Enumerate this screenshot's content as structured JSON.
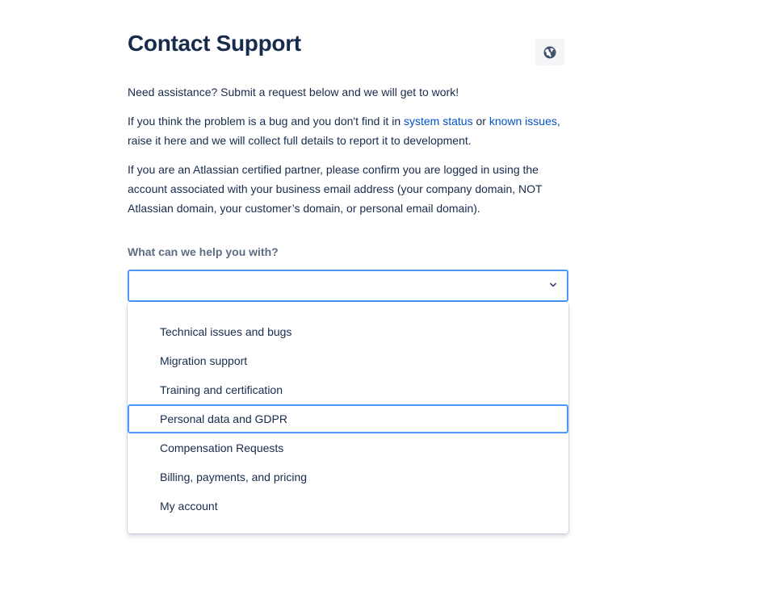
{
  "header": {
    "title": "Contact Support",
    "language_button_icon": "globe-icon"
  },
  "intro": {
    "line1": "Need assistance? Submit a request below and we will get to work!",
    "bug_text_before": "If you think the problem is a bug and you don't find it in ",
    "system_status_link": "system status",
    "bug_text_or": " or ",
    "known_issues_link": "known issues",
    "bug_text_after": ", raise it here and we will collect full details to report it to development.",
    "partner_text": "If you are an Atlassian certified partner, please confirm you are logged in using the account associated with your business email address (your company domain, NOT Atlassian domain, your customer’s domain, or personal email domain)."
  },
  "form": {
    "help_label": "What can we help you with?",
    "select_value": "",
    "options": [
      "Technical issues and bugs",
      "Migration support",
      "Training and certification",
      "Personal data and GDPR",
      "Compensation Requests",
      "Billing, payments, and pricing",
      "My account"
    ],
    "focused_option": "Personal data and GDPR"
  },
  "colors": {
    "link": "#0052cc",
    "focus_border": "#4c9aff",
    "text": "#172b4d",
    "label": "#5e6c84"
  }
}
